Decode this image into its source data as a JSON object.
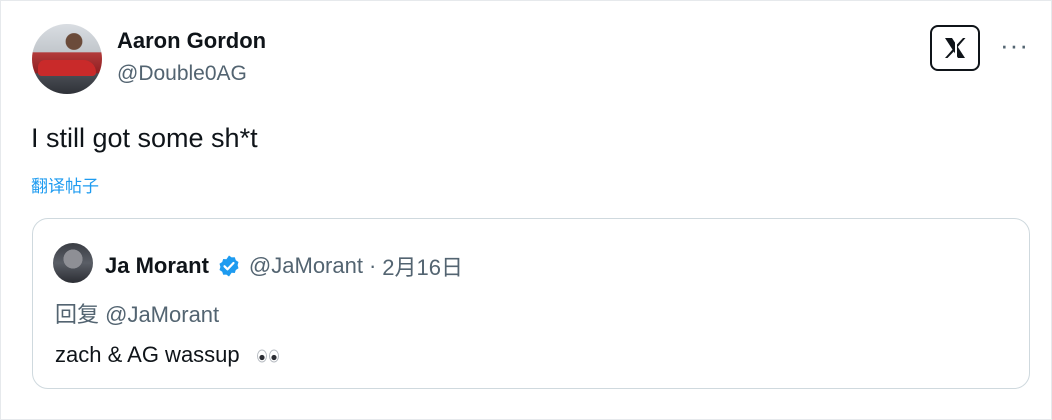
{
  "author": {
    "name": "Aaron Gordon",
    "handle": "@Double0AG"
  },
  "post": {
    "text": "I still got some sh*t",
    "translate_label": "翻译帖子"
  },
  "quoted": {
    "name": "Ja Morant",
    "verified": true,
    "handle": "@JaMorant",
    "separator": "·",
    "date": "2月16日",
    "reply_to": "回复 @JaMorant",
    "text": "zach & AG wassup",
    "emoji": "eyes"
  },
  "icons": {
    "brand": "x-logo-icon",
    "more": "more-icon",
    "verified": "verified-badge-icon"
  },
  "colors": {
    "link": "#1d9bf0",
    "secondary_text": "#536471",
    "primary_text": "#0f1419",
    "border": "#cfd9de"
  }
}
